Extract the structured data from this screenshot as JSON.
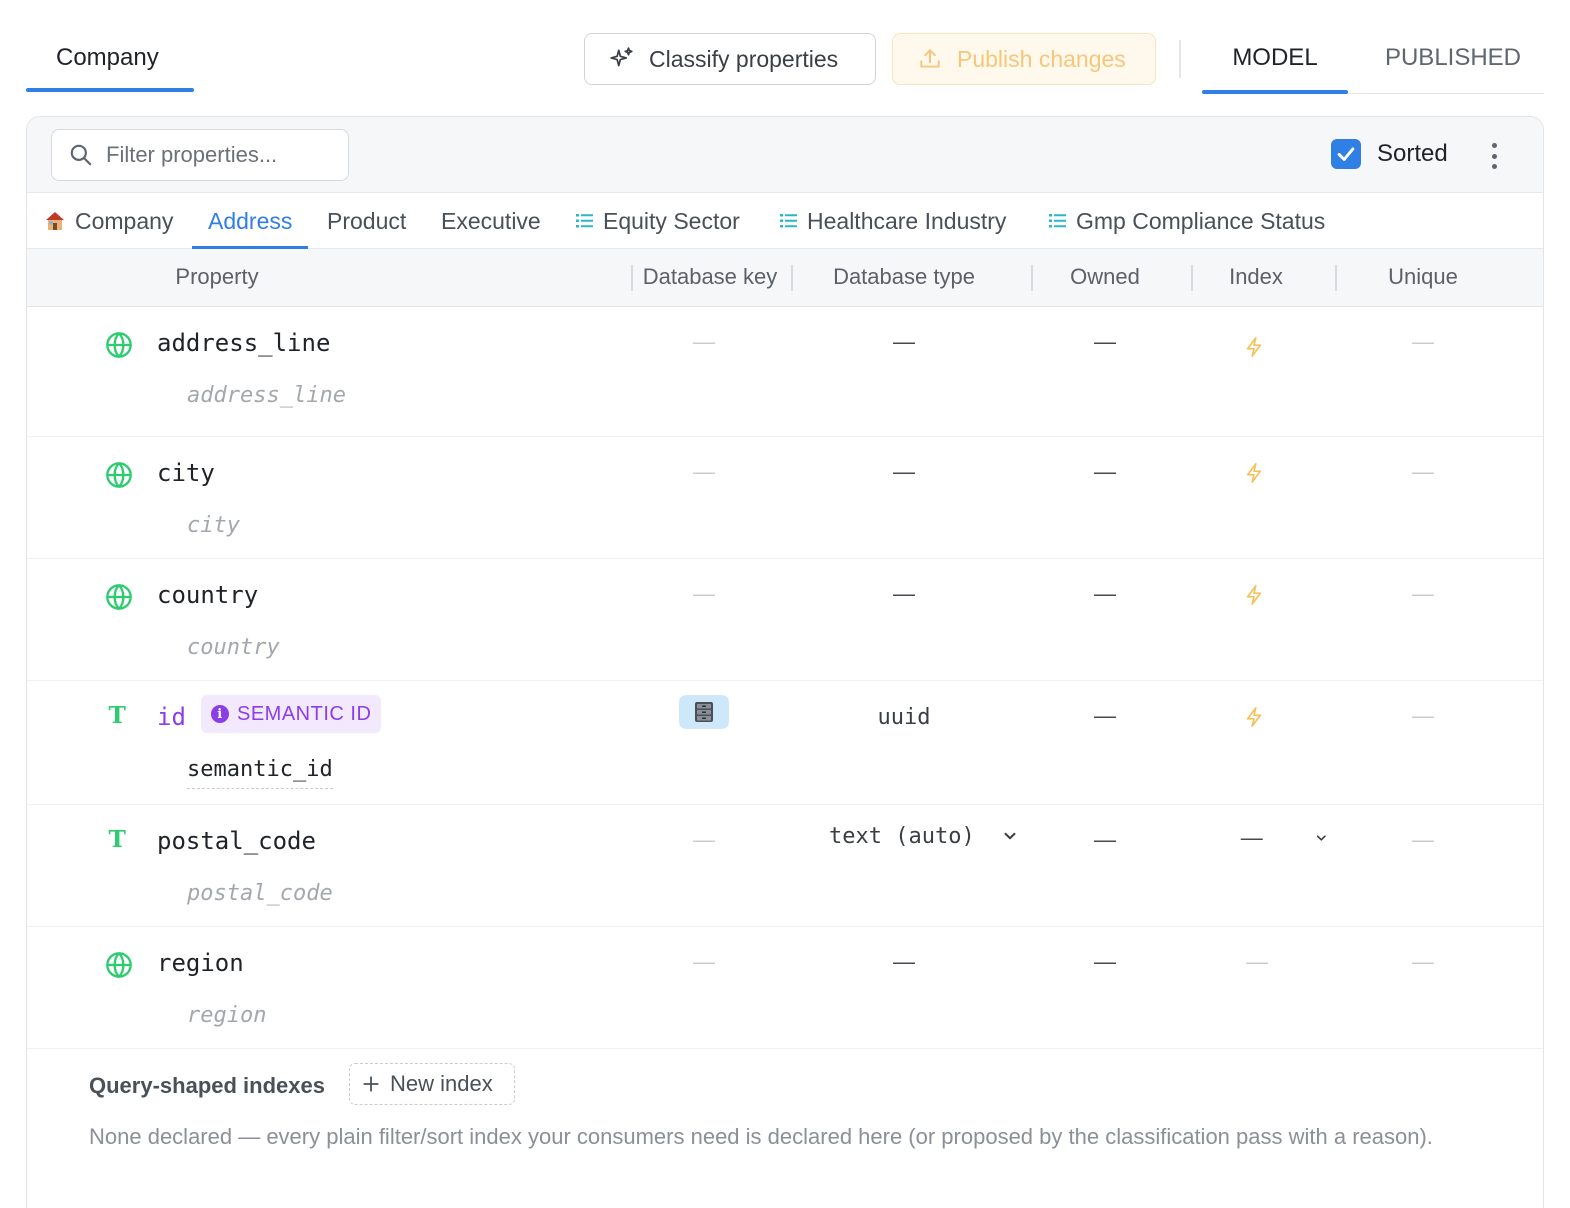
{
  "header": {
    "entity_tab": "Company",
    "classify_label": "Classify properties",
    "publish_label": "Publish changes",
    "mode_tabs": [
      "MODEL",
      "PUBLISHED"
    ]
  },
  "toolbar": {
    "filter_placeholder": "Filter properties...",
    "sorted_label": "Sorted",
    "sorted_checked": true
  },
  "type_tabs": [
    {
      "label": "Company",
      "icon": "house-icon"
    },
    {
      "label": "Address",
      "active": true
    },
    {
      "label": "Product"
    },
    {
      "label": "Executive"
    },
    {
      "label": "Equity Sector",
      "icon": "list-icon"
    },
    {
      "label": "Healthcare Industry",
      "icon": "list-icon"
    },
    {
      "label": "Gmp Compliance Status",
      "icon": "list-icon"
    }
  ],
  "columns": [
    "Property",
    "Database key",
    "Database type",
    "Owned",
    "Index",
    "Unique"
  ],
  "rows": [
    {
      "name": "address_line",
      "key": "address_line",
      "icon": "globe-icon",
      "db_key": "—",
      "db_type": "—",
      "owned": "—",
      "index": "⚡",
      "unique": "—"
    },
    {
      "name": "city",
      "key": "city",
      "icon": "globe-icon",
      "db_key": "—",
      "db_type": "—",
      "owned": "—",
      "index": "⚡",
      "unique": "—"
    },
    {
      "name": "country",
      "key": "country",
      "icon": "globe-icon",
      "db_key": "—",
      "db_type": "—",
      "owned": "—",
      "index": "⚡",
      "unique": "—"
    },
    {
      "name": "id",
      "key": "semantic_id",
      "icon": "text-type-icon",
      "badge": "SEMANTIC ID",
      "db_key_icon": "cabinet-icon",
      "db_type": "uuid",
      "owned": "—",
      "index": "⚡",
      "unique": "—"
    },
    {
      "name": "postal_code",
      "key": "postal_code",
      "icon": "text-type-icon",
      "db_key": "—",
      "db_type": "text (auto)",
      "owned": "—",
      "index": "—",
      "unique": "—"
    },
    {
      "name": "region",
      "key": "region",
      "icon": "globe-icon",
      "db_key": "—",
      "db_type": "—",
      "owned": "—",
      "index": "—",
      "unique": "—"
    }
  ],
  "footer": {
    "title": "Query-shaped indexes",
    "new_index_label": "New index",
    "description": "None declared — every plain filter/sort index your consumers need is declared here (or proposed by the classification pass with a reason)."
  },
  "colors": {
    "accent": "#2f7fe4",
    "globe": "#2ecc71",
    "semantic": "#8b3ee8",
    "bolt": "#f5c15a",
    "publish": "#f6c77a"
  }
}
